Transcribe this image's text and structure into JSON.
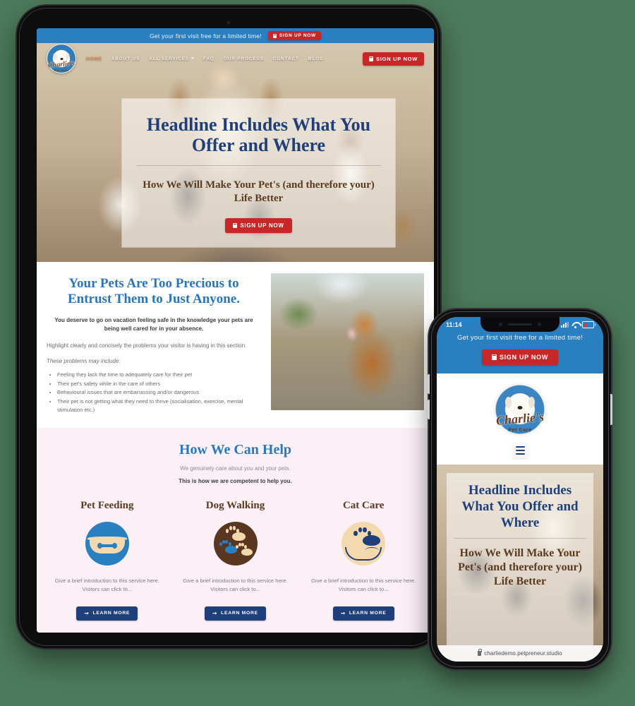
{
  "tablet": {
    "promo": {
      "text": "Get your first visit free for a limited time!",
      "cta": "SIGN UP NOW"
    },
    "logo": {
      "word": "Charlie's",
      "sub": "Pet Care"
    },
    "nav": {
      "items": [
        {
          "label": "HOME",
          "active": true
        },
        {
          "label": "ABOUT US",
          "active": false
        },
        {
          "label": "ALL SERVICES",
          "active": false,
          "has_caret": true
        },
        {
          "label": "FAQ",
          "active": false
        },
        {
          "label": "OUR PROCESS",
          "active": false
        },
        {
          "label": "CONTACT",
          "active": false
        },
        {
          "label": "BLOG",
          "active": false
        }
      ],
      "cta": "SIGN UP NOW"
    },
    "hero": {
      "headline": "Headline Includes What You Offer and Where",
      "subheadline": "How We Will Make Your Pet's (and therefore your) Life Better",
      "cta": "SIGN UP NOW"
    },
    "precious": {
      "heading": "Your Pets Are Too Precious to Entrust Them to Just Anyone.",
      "lead": "You deserve to go on vacation feeling safe in the knowledge your pets are being well cared for in your absence.",
      "paragraph": "Highlight clearly and concisely the problems your visitor is having in this section.",
      "list_intro": "These problems may include:",
      "list": [
        "Feeling they lack the time to adequately care for their pet",
        "Their pet's safety while in the care of others",
        "Behavioural issues that are embarrassing and/or dangerous",
        "Their pet is not getting what they need to thrive (socialisation, exercise, mental stimulation etc.)"
      ]
    },
    "help": {
      "heading": "How We Can Help",
      "subtitle": "We genuinely care about you and your pets.",
      "subtitle2": "This is how we are competent to help you.",
      "cards": [
        {
          "title": "Pet Feeding",
          "copy": "Give a brief introduction to this service here. Visitors can click to...",
          "cta": "LEARN MORE",
          "icon": "dog-bowl-icon"
        },
        {
          "title": "Dog Walking",
          "copy": "Give a brief introduction to this service here. Visitors can click to...",
          "cta": "LEARN MORE",
          "icon": "paw-prints-icon"
        },
        {
          "title": "Cat Care",
          "copy": "Give a brief introduction to this service here. Visitors can click to...",
          "cta": "LEARN MORE",
          "icon": "paw-in-hand-icon"
        }
      ]
    }
  },
  "phone": {
    "status": {
      "time": "11:14",
      "signal": "signal-icon",
      "wifi": "wifi-icon",
      "battery": "battery-icon"
    },
    "promo": {
      "text": "Get your first visit free for a limited time!",
      "cta": "SIGN UP NOW"
    },
    "logo": {
      "word": "Charlie's",
      "sub": "Pet Care"
    },
    "menu": "hamburger-menu-icon",
    "hero": {
      "headline": "Headline Includes What You Offer and Where",
      "subheadline": "How We Will Make Your Pet's (and therefore your) Life Better"
    },
    "url": "charliedemo.petpreneur.studio"
  },
  "colors": {
    "promo_blue": "#2a7fc1",
    "cta_red": "#c62828",
    "navy": "#1f3f7a",
    "brown": "#5b3a20",
    "help_bg": "#faf0f6",
    "olive": "#a8ad3a"
  }
}
